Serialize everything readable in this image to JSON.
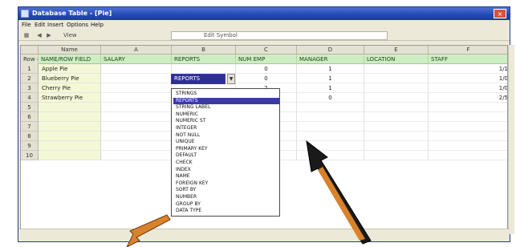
{
  "window": {
    "title": "Database Table - [Pie]",
    "close_label": "×"
  },
  "menu": [
    "File",
    "Edit",
    "Insert",
    "Options",
    "Help"
  ],
  "toolbar": {
    "view_label": "View",
    "filter_label": "Edit Symbol"
  },
  "columns": [
    "Name",
    "A",
    "B",
    "C",
    "D",
    "E",
    "F"
  ],
  "fields": [
    "Row #",
    "NAME/ROW FIELD",
    "SALARY",
    "REPORTS",
    "NUM EMP",
    "MANAGER",
    "LOCATION",
    "STAFF"
  ],
  "active_cell_value": "REPORTS",
  "rows": [
    {
      "num": "1",
      "name": "Apple Pie",
      "c": "0",
      "d": "1",
      "e": "",
      "f": "1/1"
    },
    {
      "num": "2",
      "name": "Blueberry Pie",
      "c": "0",
      "d": "1",
      "e": "",
      "f": "1/0"
    },
    {
      "num": "3",
      "name": "Cherry Pie",
      "c": "2",
      "d": "1",
      "e": "",
      "f": "1/0"
    },
    {
      "num": "4",
      "name": "Strawberry Pie",
      "c": "1",
      "d": "0",
      "e": "",
      "f": "2/5"
    },
    {
      "num": "5",
      "name": "",
      "c": "",
      "d": "",
      "e": "",
      "f": ""
    },
    {
      "num": "6",
      "name": "",
      "c": "",
      "d": "",
      "e": "",
      "f": ""
    },
    {
      "num": "7",
      "name": "",
      "c": "",
      "d": "",
      "e": "",
      "f": ""
    },
    {
      "num": "8",
      "name": "",
      "c": "",
      "d": "",
      "e": "",
      "f": ""
    },
    {
      "num": "9",
      "name": "",
      "c": "",
      "d": "",
      "e": "",
      "f": ""
    },
    {
      "num": "10",
      "name": "",
      "c": "",
      "d": "",
      "e": "",
      "f": ""
    }
  ],
  "dropdown": {
    "items": [
      "STRINGS",
      "REPORTS",
      "STRING LABEL",
      "NUMERIC",
      "NUMERIC ST",
      "INTEGER",
      "NOT NULL",
      "UNIQUE",
      "PRIMARY KEY",
      "DEFAULT",
      "CHECK",
      "INDEX",
      "NAME",
      "FOREIGN KEY",
      "SORT BY",
      "NUMBER",
      "GROUP BY",
      "DATA TYPE"
    ],
    "selected_index": 1
  },
  "colors": {
    "title_bar": "#2349b6",
    "field_row": "#cdeec3",
    "name_col": "#f5f8d6",
    "selection": "#3a3aa8"
  }
}
